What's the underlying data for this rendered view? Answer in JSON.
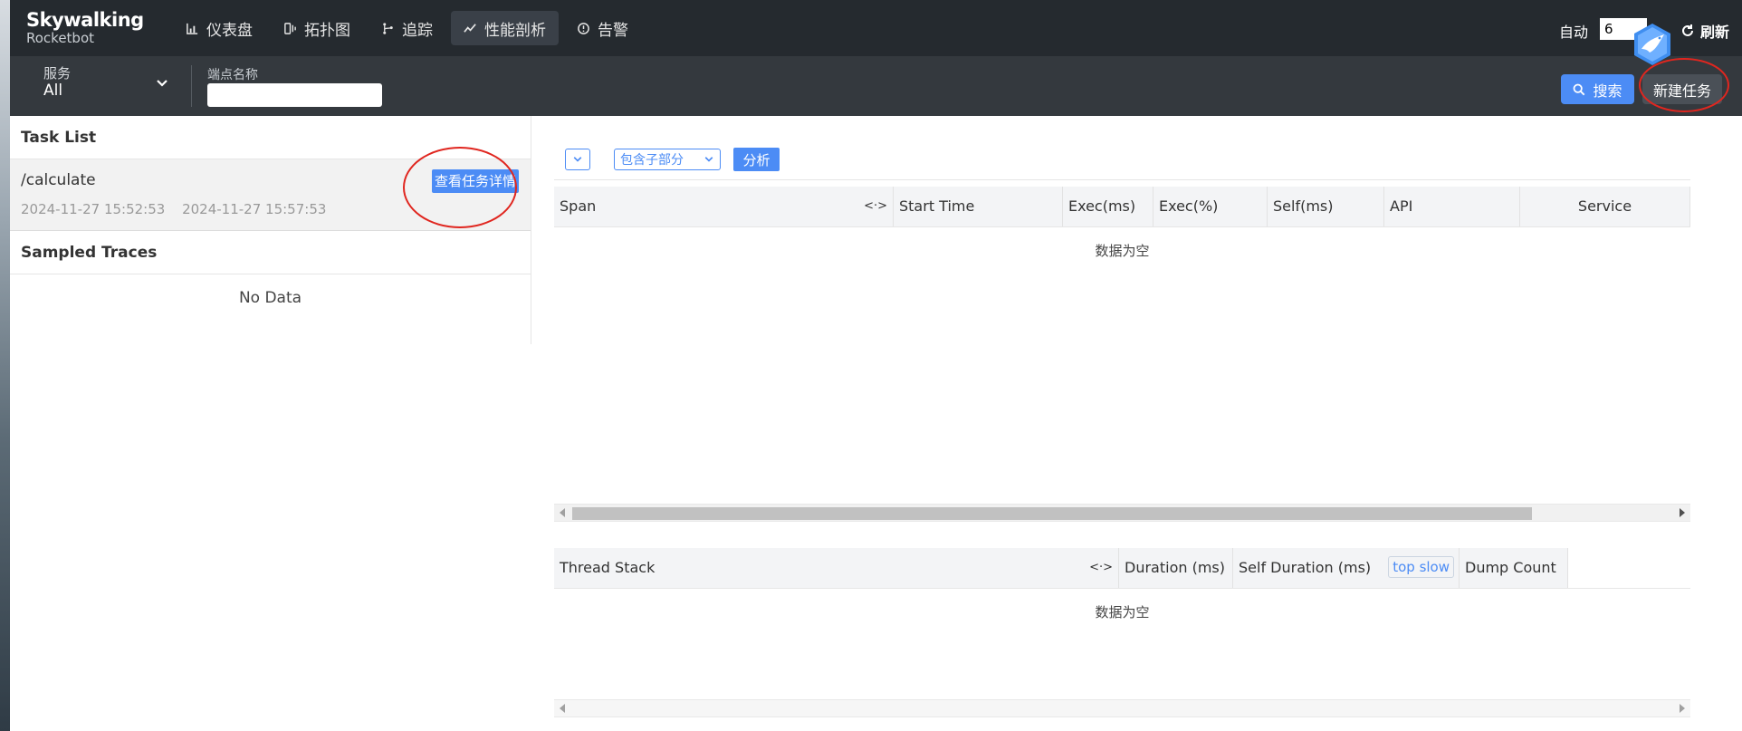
{
  "logo": {
    "title": "Skywalking",
    "subtitle": "Rocketbot"
  },
  "nav": [
    {
      "label": "仪表盘",
      "icon": "dashboard-chart-icon"
    },
    {
      "label": "拓扑图",
      "icon": "topology-icon"
    },
    {
      "label": "追踪",
      "icon": "trace-branch-icon"
    },
    {
      "label": "性能剖析",
      "icon": "profile-trend-icon",
      "active": true
    },
    {
      "label": "告警",
      "icon": "alarm-clock-icon"
    }
  ],
  "topright": {
    "auto_label": "自动",
    "interval_value": "6",
    "refresh_label": "刷新"
  },
  "toolbar": {
    "service_label": "服务",
    "service_value": "All",
    "endpoint_label": "端点名称",
    "search_label": "搜索",
    "new_task_label": "新建任务"
  },
  "task_list": {
    "title": "Task List",
    "items": [
      {
        "name": "/calculate",
        "start": "2024-11-27 15:52:53",
        "end": "2024-11-27 15:57:53",
        "detail_label": "查看任务详情"
      }
    ]
  },
  "sampled": {
    "title": "Sampled Traces",
    "empty": "No Data"
  },
  "analysis": {
    "mode_value": "包含子部分",
    "analyze_label": "分析",
    "span_columns": [
      "Span",
      "Start Time",
      "Exec(ms)",
      "Exec(%)",
      "Self(ms)",
      "API",
      "Service"
    ],
    "span_toggle": "<·>",
    "span_empty": "数据为空",
    "thread_columns": [
      "Thread Stack",
      "Duration (ms)",
      "Self Duration (ms)",
      "Dump Count"
    ],
    "thread_toggle": "<·>",
    "top_slow": "top slow",
    "thread_empty": "数据为空"
  },
  "colors": {
    "accent": "#4c8cf5",
    "topbar": "#252a2f",
    "toolbar": "#34393e",
    "annotation": "#e0261f"
  }
}
